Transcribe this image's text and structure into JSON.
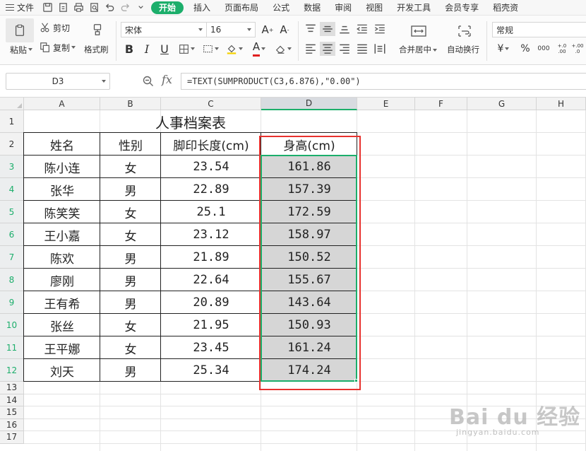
{
  "menu": {
    "file_label": "文件",
    "tabs": [
      "开始",
      "插入",
      "页面布局",
      "公式",
      "数据",
      "审阅",
      "视图",
      "开发工具",
      "会员专享",
      "稻壳资"
    ],
    "active_tab": "开始"
  },
  "ribbon": {
    "paste": "粘贴",
    "cut": "剪切",
    "copy": "复制",
    "format_painter": "格式刷",
    "font_name": "宋体",
    "font_size": "16",
    "bold": "B",
    "italic": "I",
    "underline": "U",
    "grow_font": "A",
    "shrink_font": "A",
    "font_color_glyph": "A",
    "merge_center": "合并居中",
    "wrap_text": "自动换行",
    "number_format": "常规",
    "currency": "¥",
    "percent": "%",
    "thousands": "000",
    "inc_decimal": "+.0 .00",
    "dec_decimal": "+.00 .0"
  },
  "formula_bar": {
    "name_box": "D3",
    "fx": "fx",
    "formula": "=TEXT(SUMPRODUCT(C3,6.876),\"0.00\")"
  },
  "sheet": {
    "columns": [
      "A",
      "B",
      "C",
      "D",
      "E",
      "F",
      "G",
      "H"
    ],
    "rows": [
      "1",
      "2",
      "3",
      "4",
      "5",
      "6",
      "7",
      "8",
      "9",
      "10",
      "11",
      "12",
      "13",
      "14",
      "15",
      "16",
      "17"
    ],
    "selected_column": "D",
    "title": "人事档案表",
    "headers": [
      "姓名",
      "性别",
      "脚印长度(cm)",
      "身高(cm)"
    ],
    "records": [
      [
        "陈小连",
        "女",
        "23.54",
        "161.86"
      ],
      [
        "张华",
        "男",
        "22.89",
        "157.39"
      ],
      [
        "陈笑笑",
        "女",
        "25.1",
        "172.59"
      ],
      [
        "王小嘉",
        "女",
        "23.12",
        "158.97"
      ],
      [
        "陈欢",
        "男",
        "21.89",
        "150.52"
      ],
      [
        "廖刚",
        "男",
        "22.64",
        "155.67"
      ],
      [
        "王有希",
        "男",
        "20.89",
        "143.64"
      ],
      [
        "张丝",
        "女",
        "21.95",
        "150.93"
      ],
      [
        "王平娜",
        "女",
        "23.45",
        "161.24"
      ],
      [
        "刘天",
        "男",
        "25.34",
        "174.24"
      ]
    ]
  },
  "watermark": {
    "main": "Bai du 经验",
    "sub": "jingyan.baidu.com"
  },
  "colors": {
    "accent": "#1cae6b",
    "annotation": "#e8322e",
    "selection_fill": "#d6d6d6"
  }
}
